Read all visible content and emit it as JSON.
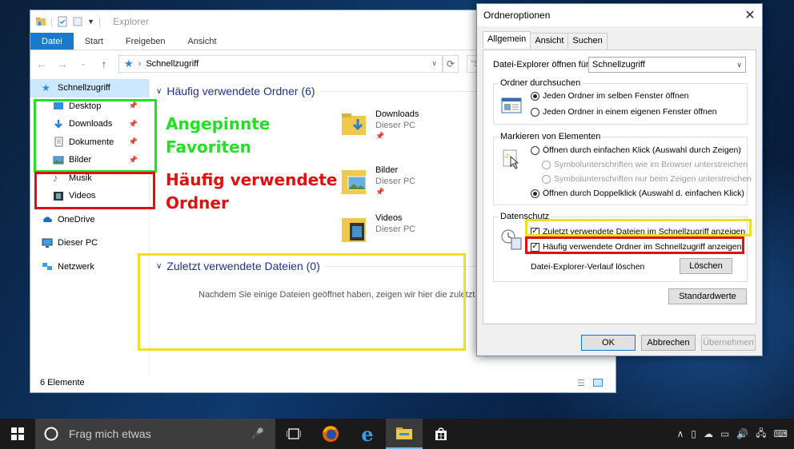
{
  "explorer": {
    "title": "Explorer",
    "ribbon_tabs": [
      "Datei",
      "Start",
      "Freigeben",
      "Ansicht"
    ],
    "address": "Schnellzugriff",
    "search_placeholder": "\"Sc",
    "sidebar": {
      "quick_access": "Schnellzugriff",
      "pinned": [
        "Desktop",
        "Downloads",
        "Dokumente",
        "Bilder"
      ],
      "frequent": [
        "Musik",
        "Videos"
      ],
      "onedrive": "OneDrive",
      "this_pc": "Dieser PC",
      "network": "Netzwerk"
    },
    "frequent_header": "Häufig verwendete Ordner (6)",
    "frequent_folders": [
      {
        "name": "Downloads",
        "location": "Dieser PC"
      },
      {
        "name": "Bilder",
        "location": "Dieser PC"
      },
      {
        "name": "Videos",
        "location": "Dieser PC"
      }
    ],
    "recent_header": "Zuletzt verwendete Dateien (0)",
    "recent_empty": "Nachdem Sie einige Dateien geöffnet haben, zeigen wir hier die zuletzt",
    "status": "6 Elemente"
  },
  "annotations": {
    "pinned": [
      "Angepinnte",
      "Favoriten"
    ],
    "frequent": [
      "Häufig verwendete",
      "Ordner"
    ],
    "colors": {
      "green": "#22e022",
      "red": "#e01010",
      "yellow": "#f0e020"
    }
  },
  "dialog": {
    "title": "Ordneroptionen",
    "tabs": [
      "Allgemein",
      "Ansicht",
      "Suchen"
    ],
    "open_for_label": "Datei-Explorer öffnen für:",
    "open_for_value": "Schnellzugriff",
    "browse": {
      "title": "Ordner durchsuchen",
      "opt1": "Jeden Ordner im selben Fenster öffnen",
      "opt2": "Jeden Ordner in einem eigenen Fenster öffnen"
    },
    "click": {
      "title": "Markieren von Elementen",
      "opt1": "Öffnen durch einfachen Klick (Auswahl durch Zeigen)",
      "opt1a": "Symbolunterschriften wie im Browser unterstreichen",
      "opt1b": "Symbolunterschriften nur beim Zeigen unterstreichen",
      "opt2": "Öffnen durch Doppelklick (Auswahl d. einfachen Klick)"
    },
    "privacy": {
      "title": "Datenschutz",
      "chk1": "Zuletzt verwendete Dateien im Schnellzugriff anzeigen",
      "chk2": "Häufig verwendete Ordner im Schnellzugriff anzeigen",
      "clear_label": "Datei-Explorer-Verlauf löschen",
      "clear_button": "Löschen"
    },
    "defaults_button": "Standardwerte",
    "ok": "OK",
    "cancel": "Abbrechen",
    "apply": "Übernehmen"
  },
  "taskbar": {
    "search_placeholder": "Frag mich etwas"
  }
}
